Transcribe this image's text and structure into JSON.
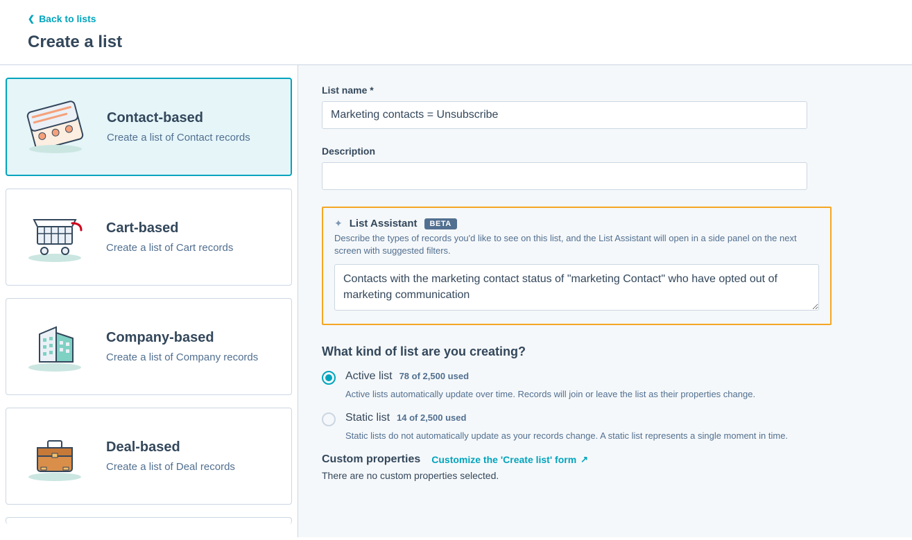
{
  "nav": {
    "back_label": "Back to lists"
  },
  "page_title": "Create a list",
  "cards": [
    {
      "title": "Contact-based",
      "desc": "Create a list of Contact records",
      "selected": true
    },
    {
      "title": "Cart-based",
      "desc": "Create a list of Cart records",
      "selected": false
    },
    {
      "title": "Company-based",
      "desc": "Create a list of Company records",
      "selected": false
    },
    {
      "title": "Deal-based",
      "desc": "Create a list of Deal records",
      "selected": false
    }
  ],
  "form": {
    "list_name_label": "List name *",
    "list_name_value": "Marketing contacts = Unsubscribe",
    "description_label": "Description",
    "description_value": ""
  },
  "assistant": {
    "title": "List Assistant",
    "badge": "BETA",
    "help": "Describe the types of records you'd like to see on this list, and the List Assistant will open in a side panel on the next screen with suggested filters.",
    "value": "Contacts with the marketing contact status of \"marketing Contact\" who have opted out of marketing communication"
  },
  "list_kind": {
    "heading": "What kind of list are you creating?",
    "options": [
      {
        "title": "Active list",
        "usage": "78 of 2,500 used",
        "desc": "Active lists automatically update over time. Records will join or leave the list as their properties change.",
        "checked": true
      },
      {
        "title": "Static list",
        "usage": "14 of 2,500 used",
        "desc": "Static lists do not automatically update as your records change. A static list represents a single moment in time.",
        "checked": false
      }
    ]
  },
  "custom": {
    "label": "Custom properties",
    "link": "Customize the 'Create list' form",
    "empty": "There are no custom properties selected."
  }
}
